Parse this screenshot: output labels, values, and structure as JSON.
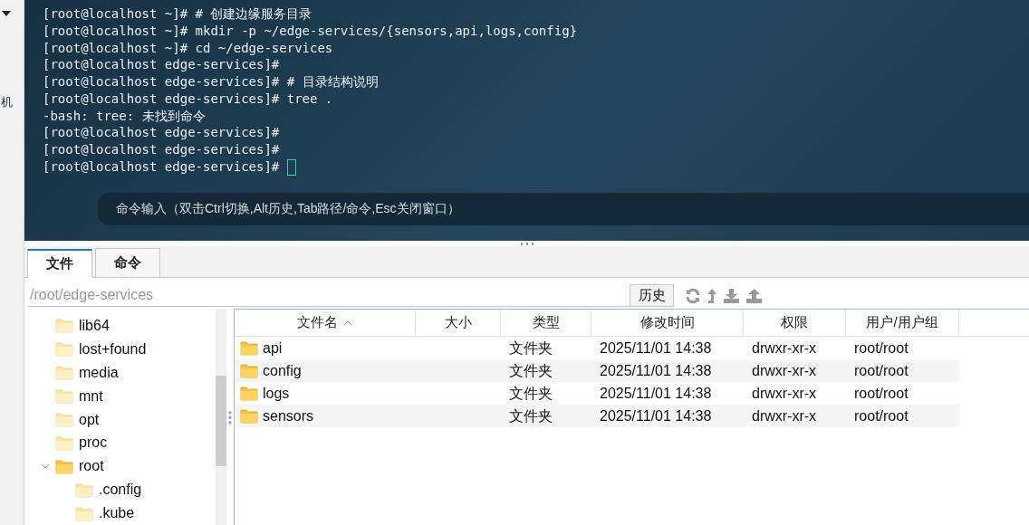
{
  "side_strip": {
    "label": "机"
  },
  "terminal": {
    "lines": [
      "[root@localhost ~]# # 创建边缘服务目录",
      "[root@localhost ~]# mkdir -p ~/edge-services/{sensors,api,logs,config}",
      "[root@localhost ~]# cd ~/edge-services",
      "[root@localhost edge-services]#",
      "[root@localhost edge-services]# # 目录结构说明",
      "[root@localhost edge-services]# tree .",
      "-bash: tree: 未找到命令",
      "[root@localhost edge-services]#",
      "[root@localhost edge-services]#",
      "[root@localhost edge-services]#"
    ],
    "cursor": true,
    "command_hint": "命令输入（双击Ctrl切换,Alt历史,Tab路径/命令,Esc关闭窗口）"
  },
  "tabs": [
    {
      "label": "文件",
      "selected": true
    },
    {
      "label": "命令",
      "selected": false
    }
  ],
  "path": "/root/edge-services",
  "history_button": "历史",
  "tree": [
    {
      "name": "lib64"
    },
    {
      "name": "lost+found"
    },
    {
      "name": "media"
    },
    {
      "name": "mnt"
    },
    {
      "name": "opt"
    },
    {
      "name": "proc"
    },
    {
      "name": "root",
      "expanded": true,
      "children": [
        {
          "name": ".config"
        },
        {
          "name": ".kube"
        }
      ]
    }
  ],
  "table": {
    "columns": [
      "文件名",
      "大小",
      "类型",
      "修改时间",
      "权限",
      "用户/用户组"
    ],
    "rows": [
      [
        "api",
        "",
        "文件夹",
        "2025/11/01 14:38",
        "drwxr-xr-x",
        "root/root"
      ],
      [
        "config",
        "",
        "文件夹",
        "2025/11/01 14:38",
        "drwxr-xr-x",
        "root/root"
      ],
      [
        "logs",
        "",
        "文件夹",
        "2025/11/01 14:38",
        "drwxr-xr-x",
        "root/root"
      ],
      [
        "sensors",
        "",
        "文件夹",
        "2025/11/01 14:38",
        "drwxr-xr-x",
        "root/root"
      ]
    ]
  }
}
